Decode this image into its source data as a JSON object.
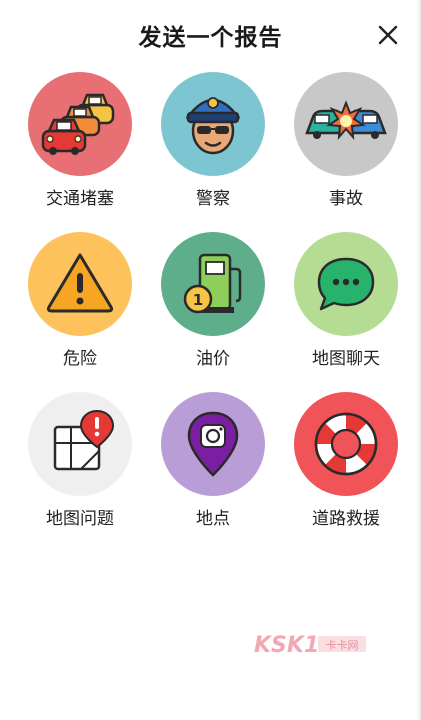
{
  "header": {
    "title": "发送一个报告",
    "close_icon": "close-icon"
  },
  "items": [
    {
      "label": "交通堵塞",
      "icon": "traffic-jam-icon",
      "color": "#E86F73"
    },
    {
      "label": "警察",
      "icon": "police-icon",
      "color": "#7EC5D2"
    },
    {
      "label": "事故",
      "icon": "accident-icon",
      "color": "#C8C8C8"
    },
    {
      "label": "危险",
      "icon": "hazard-icon",
      "color": "#FDC25C"
    },
    {
      "label": "油价",
      "icon": "gas-price-icon",
      "color": "#5FAE8B"
    },
    {
      "label": "地图聊天",
      "icon": "map-chat-icon",
      "color": "#B5DC93"
    },
    {
      "label": "地图问题",
      "icon": "map-issue-icon",
      "color": "#EFEFEF"
    },
    {
      "label": "地点",
      "icon": "place-icon",
      "color": "#B89DD6"
    },
    {
      "label": "道路救援",
      "icon": "roadside-help-icon",
      "color": "#F15458"
    }
  ],
  "watermark": {
    "text": "KSK1",
    "subtext": "卡卡网"
  },
  "colors": {
    "title": "#1a1a1a",
    "label": "#222222",
    "watermark": "#F08A9A"
  }
}
